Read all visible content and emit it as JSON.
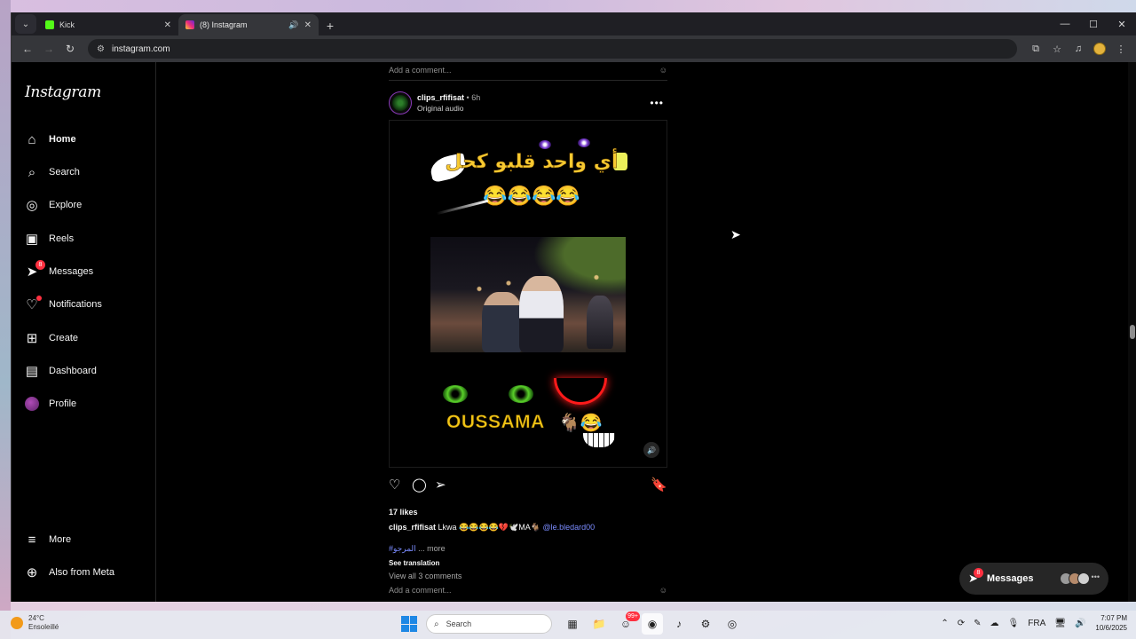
{
  "browser": {
    "tabs": [
      {
        "label": "Kick",
        "icon": "kick-icon",
        "active": false
      },
      {
        "label": "(8) Instagram",
        "icon": "instagram-icon",
        "active": true
      }
    ],
    "url": "instagram.com"
  },
  "sidebar": {
    "logo": "Instagram",
    "items": [
      {
        "label": "Home",
        "icon": "home-icon"
      },
      {
        "label": "Search",
        "icon": "search-icon"
      },
      {
        "label": "Explore",
        "icon": "compass-icon"
      },
      {
        "label": "Reels",
        "icon": "reels-icon"
      },
      {
        "label": "Messages",
        "icon": "messenger-icon",
        "badge": "8"
      },
      {
        "label": "Notifications",
        "icon": "heart-icon"
      },
      {
        "label": "Create",
        "icon": "plus-square-icon"
      },
      {
        "label": "Dashboard",
        "icon": "dashboard-icon"
      },
      {
        "label": "Profile",
        "icon": "avatar"
      }
    ],
    "more": "More",
    "also_from_meta": "Also from Meta"
  },
  "feed": {
    "prev_add_comment": "Add a comment...",
    "post": {
      "username": "clips_rfifisat",
      "time": "6h",
      "audio": "Original audio",
      "media_text_top": "أي واحد قلبو كحل",
      "media_emojis": "😂😂😂😂",
      "media_text_bottom": "OUSSAMA",
      "likes": "17 likes",
      "caption_user": "clips_rfifisat",
      "caption_text": "Lkwa 😂😂😂😂💔🕊️MA🐐",
      "caption_mention": "@le.bledard00",
      "hashtag": "#المرجو",
      "more": "... more",
      "see_translation": "See translation",
      "view_comments": "View all 3 comments",
      "add_comment": "Add a comment..."
    }
  },
  "messages_pill": {
    "label": "Messages",
    "badge": "8"
  },
  "taskbar": {
    "weather_temp": "24°C",
    "weather_desc": "Ensoleillé",
    "search_placeholder": "Search",
    "tray_lang": "FRA",
    "time": "7:07 PM",
    "date": "10/6/2025",
    "notif_badge": "99+"
  }
}
